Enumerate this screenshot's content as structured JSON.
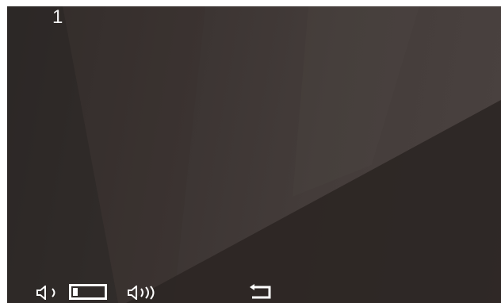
{
  "screen": {
    "channel_number": "1"
  },
  "controls": {
    "volume_down_icon": "volume-down-icon",
    "volume_level_icon": "volume-level-bar",
    "volume_up_icon": "volume-up-icon",
    "back_icon": "back-arrow-icon",
    "volume_level": 0.15
  },
  "colors": {
    "icon": "#ffffff",
    "background_dark": "#2f2a28",
    "background_light": "#4a4240"
  }
}
